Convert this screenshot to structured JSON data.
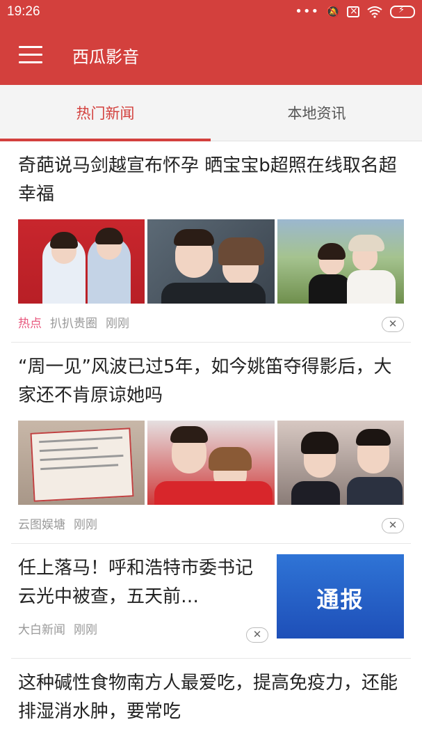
{
  "status_bar": {
    "time": "19:26",
    "icons": [
      "more-dots-icon",
      "mute-bell-icon",
      "sim-blocked-icon",
      "wifi-icon",
      "battery-charging-icon"
    ]
  },
  "app_bar": {
    "title": "西瓜影音",
    "menu_icon": "hamburger-icon"
  },
  "tabs": [
    {
      "label": "热门新闻",
      "active": true
    },
    {
      "label": "本地资讯",
      "active": false
    }
  ],
  "colors": {
    "brand": "#d3403d",
    "hot_tag": "#e8587e",
    "meta_text": "#999999"
  },
  "feed": [
    {
      "title": "奇葩说马剑越宣布怀孕 晒宝宝b超照在线取名超幸福",
      "tag": "热点",
      "source": "扒扒贵圈",
      "time": "刚刚",
      "images": [
        "couple-red-background-photo",
        "couple-selfie-photo",
        "couple-wedding-photo"
      ]
    },
    {
      "title": "“周一见”风波已过5年，如今姚笛夺得影后，大家还不肯原谅她吗",
      "source": "云图娱塘",
      "time": "刚刚",
      "images": [
        "award-certificate-photo",
        "couple-hug-photo",
        "man-woman-portrait-photo"
      ]
    },
    {
      "title": "任上落马！呼和浩特市委书记云光中被查，五天前…",
      "source": "大白新闻",
      "time": "刚刚",
      "image_text": "通报"
    },
    {
      "title": "这种碱性食物南方人最爱吃，提高免疫力，还能排湿消水肿，要常吃"
    }
  ]
}
